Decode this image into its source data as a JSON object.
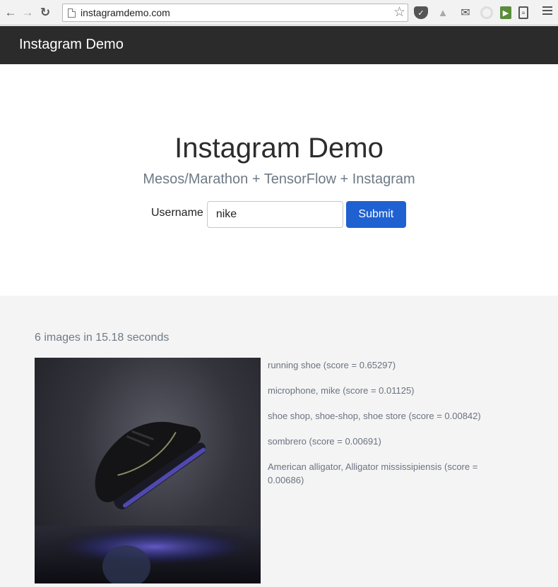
{
  "browser": {
    "url": "instagramdemo.com"
  },
  "navbar": {
    "brand": "Instagram Demo"
  },
  "hero": {
    "title": "Instagram Demo",
    "subtitle": "Mesos/Marathon + TensorFlow + Instagram",
    "form": {
      "label": "Username",
      "value": "nike",
      "submit_label": "Submit"
    }
  },
  "results": {
    "summary": "6 images in 15.18 seconds",
    "items": [
      {
        "image": "black-sneaker-photo",
        "predictions": [
          "running shoe (score = 0.65297)",
          "microphone, mike (score = 0.01125)",
          "shoe shop, shoe-shop, shoe store (score = 0.00842)",
          "sombrero (score = 0.00691)",
          "American alligator, Alligator mississipiensis (score = 0.00686)"
        ]
      }
    ]
  },
  "colors": {
    "navbar_bg": "#2b2b2b",
    "accent": "#1f61d1",
    "muted_text": "#6e7a86",
    "page_bg": "#f4f4f4"
  }
}
